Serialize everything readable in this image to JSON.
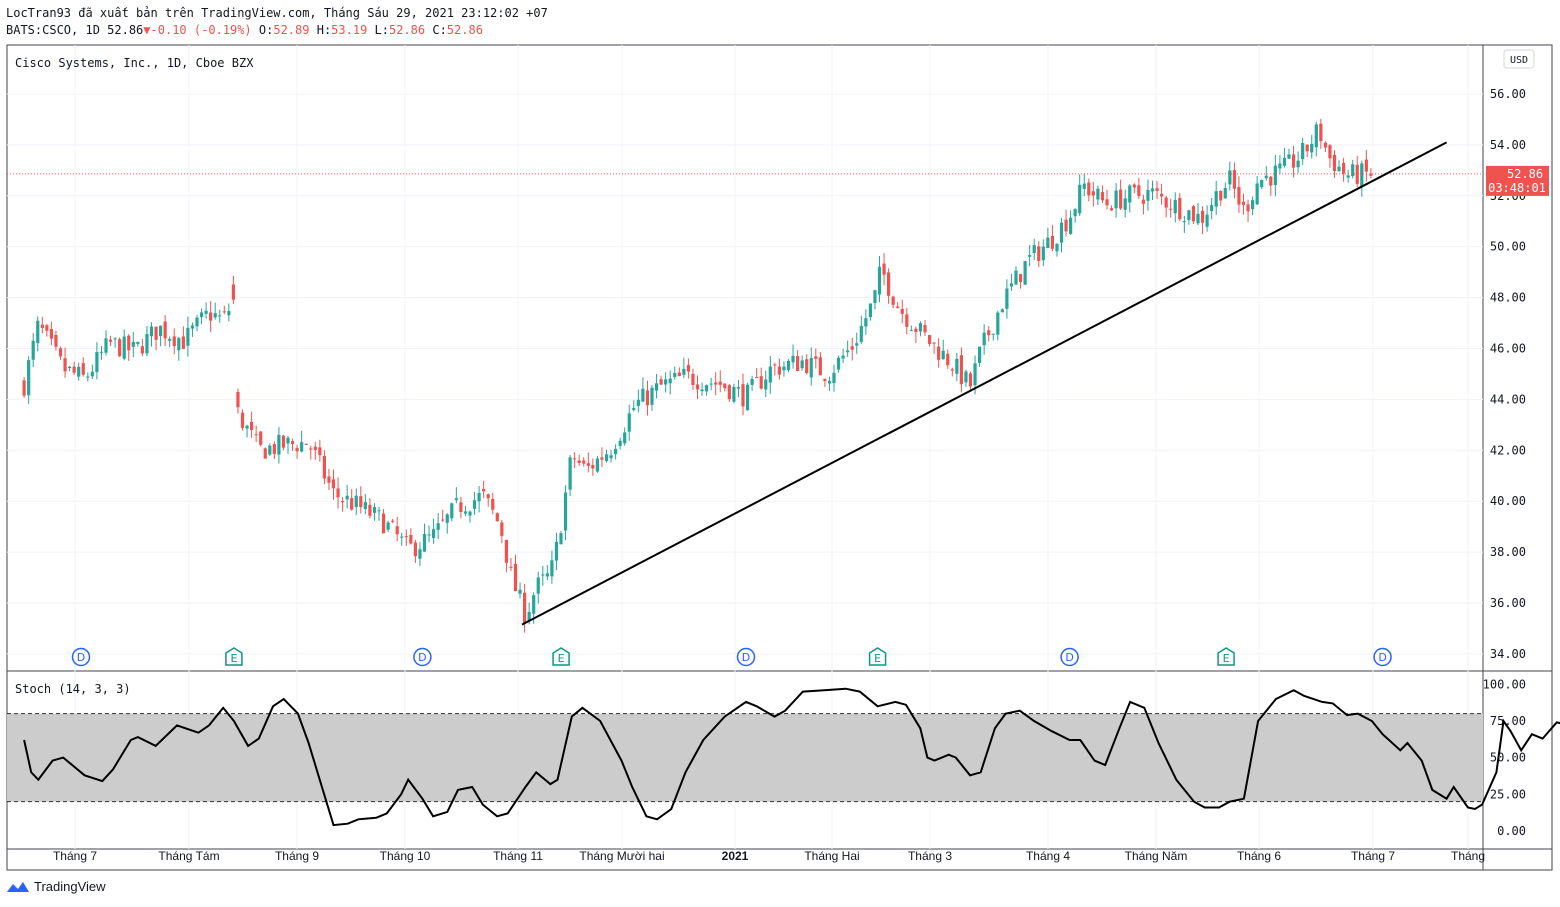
{
  "header": {
    "line1": "LocTran93 đã xuất bản trên TradingView.com, Tháng Sáu 29, 2021 23:12:02 +07",
    "symbol": "BATS:CSCO, 1D",
    "last": "52.86",
    "arrow": "▼",
    "change": "-0.10 (-0.19%)",
    "o_label": "O:",
    "o": "52.89",
    "h_label": "H:",
    "h": "53.19",
    "l_label": "L:",
    "l": "52.86",
    "c_label": "C:",
    "c": "52.86"
  },
  "footer": {
    "brand": "TradingView"
  },
  "colors": {
    "up": "#26a69a",
    "down": "#ef5350",
    "line": "#000000",
    "band": "#cccccc",
    "badge_d": "#2962ff",
    "badge_e": "#089981"
  },
  "chart_data": [
    {
      "type": "candlestick",
      "title": "Cisco Systems, Inc., 1D, Cboe BZX",
      "currency": "USD",
      "ylim": [
        34,
        56
      ],
      "yticks": [
        "56.00",
        "54.00",
        "52.00",
        "50.00",
        "48.00",
        "46.00",
        "44.00",
        "42.00",
        "40.00",
        "38.00",
        "36.00",
        "34.00"
      ],
      "last_price": "52.86",
      "countdown": "03:48:01",
      "x_labels": [
        "Tháng 7",
        "Tháng Tám",
        "Tháng 9",
        "Tháng 10",
        "Tháng 11",
        "Tháng Mười hai",
        "2021",
        "Tháng Hai",
        "Tháng 3",
        "Tháng 4",
        "Tháng Năm",
        "Tháng 6",
        "Tháng 7",
        "Tháng"
      ],
      "trendline": {
        "from": [
          "2020-11-02",
          35.15
        ],
        "to": [
          "2021-07-20",
          54.1
        ]
      },
      "markers": [
        {
          "label": "D",
          "kind": "dividend",
          "date": "2020-07-01"
        },
        {
          "label": "E",
          "kind": "earnings",
          "date": "2020-08-13"
        },
        {
          "label": "D",
          "kind": "dividend",
          "date": "2020-10-05"
        },
        {
          "label": "E",
          "kind": "earnings",
          "date": "2020-11-13"
        },
        {
          "label": "D",
          "kind": "dividend",
          "date": "2021-01-04"
        },
        {
          "label": "E",
          "kind": "earnings",
          "date": "2021-02-10"
        },
        {
          "label": "D",
          "kind": "dividend",
          "date": "2021-04-05"
        },
        {
          "label": "E",
          "kind": "earnings",
          "date": "2021-05-19"
        },
        {
          "label": "D",
          "kind": "dividend",
          "date": "2021-07-02"
        }
      ],
      "close_path": [
        [
          "2020-06-15",
          44.6
        ],
        [
          "2020-06-19",
          46.9
        ],
        [
          "2020-06-26",
          45.2
        ],
        [
          "2020-07-02",
          44.8
        ],
        [
          "2020-07-09",
          46.2
        ],
        [
          "2020-07-16",
          45.9
        ],
        [
          "2020-07-23",
          46.8
        ],
        [
          "2020-07-30",
          46.3
        ],
        [
          "2020-08-06",
          47.4
        ],
        [
          "2020-08-10",
          47.1
        ],
        [
          "2020-08-13",
          47.9
        ],
        [
          "2020-08-14",
          43.5
        ],
        [
          "2020-08-20",
          42.0
        ],
        [
          "2020-08-27",
          42.2
        ],
        [
          "2020-09-03",
          42.3
        ],
        [
          "2020-09-10",
          40.3
        ],
        [
          "2020-09-17",
          39.8
        ],
        [
          "2020-09-24",
          39.2
        ],
        [
          "2020-10-01",
          38.1
        ],
        [
          "2020-10-08",
          38.6
        ],
        [
          "2020-10-15",
          39.8
        ],
        [
          "2020-10-22",
          40.2
        ],
        [
          "2020-10-27",
          39.0
        ],
        [
          "2020-10-30",
          37.0
        ],
        [
          "2020-11-03",
          35.5
        ],
        [
          "2020-11-06",
          36.6
        ],
        [
          "2020-11-10",
          37.1
        ],
        [
          "2020-11-12",
          38.3
        ],
        [
          "2020-11-16",
          41.8
        ],
        [
          "2020-11-20",
          41.2
        ],
        [
          "2020-11-27",
          42.1
        ],
        [
          "2020-12-04",
          43.8
        ],
        [
          "2020-12-11",
          44.5
        ],
        [
          "2020-12-18",
          44.9
        ],
        [
          "2020-12-28",
          44.6
        ],
        [
          "2021-01-04",
          44.1
        ],
        [
          "2021-01-11",
          45.2
        ],
        [
          "2021-01-20",
          45.5
        ],
        [
          "2021-01-27",
          45.0
        ],
        [
          "2021-02-03",
          46.1
        ],
        [
          "2021-02-09",
          47.9
        ],
        [
          "2021-02-11",
          49.1
        ],
        [
          "2021-02-16",
          47.6
        ],
        [
          "2021-02-23",
          46.5
        ],
        [
          "2021-03-03",
          45.4
        ],
        [
          "2021-03-08",
          44.5
        ],
        [
          "2021-03-11",
          45.9
        ],
        [
          "2021-03-17",
          47.8
        ],
        [
          "2021-03-24",
          49.4
        ],
        [
          "2021-03-31",
          50.3
        ],
        [
          "2021-04-05",
          51.2
        ],
        [
          "2021-04-09",
          52.4
        ],
        [
          "2021-04-15",
          51.7
        ],
        [
          "2021-04-22",
          52.0
        ],
        [
          "2021-04-28",
          52.1
        ],
        [
          "2021-05-05",
          51.6
        ],
        [
          "2021-05-12",
          51.1
        ],
        [
          "2021-05-17",
          52.2
        ],
        [
          "2021-05-20",
          52.6
        ],
        [
          "2021-05-24",
          51.4
        ],
        [
          "2021-05-28",
          52.6
        ],
        [
          "2021-06-04",
          53.0
        ],
        [
          "2021-06-10",
          53.7
        ],
        [
          "2021-06-14",
          54.6
        ],
        [
          "2021-06-17",
          53.5
        ],
        [
          "2021-06-22",
          52.8
        ],
        [
          "2021-06-29",
          52.86
        ]
      ]
    },
    {
      "type": "line",
      "title": "Stoch (14, 3, 3)",
      "ylim": [
        0,
        100
      ],
      "yticks": [
        "100.00",
        "75.00",
        "50.00",
        "25.00",
        "0.00"
      ],
      "band": [
        20,
        80
      ],
      "series": [
        {
          "values": [
            [
              "2020-06-15",
              62
            ],
            [
              "2020-06-17",
              40
            ],
            [
              "2020-06-19",
              35
            ],
            [
              "2020-06-23",
              48
            ],
            [
              "2020-06-26",
              50
            ],
            [
              "2020-07-02",
              38
            ],
            [
              "2020-07-07",
              34
            ],
            [
              "2020-07-10",
              42
            ],
            [
              "2020-07-15",
              62
            ],
            [
              "2020-07-17",
              64
            ],
            [
              "2020-07-22",
              58
            ],
            [
              "2020-07-28",
              72
            ],
            [
              "2020-08-03",
              67
            ],
            [
              "2020-08-06",
              72
            ],
            [
              "2020-08-10",
              84
            ],
            [
              "2020-08-13",
              75
            ],
            [
              "2020-08-17",
              58
            ],
            [
              "2020-08-20",
              63
            ],
            [
              "2020-08-24",
              85
            ],
            [
              "2020-08-27",
              90
            ],
            [
              "2020-08-31",
              80
            ],
            [
              "2020-09-03",
              60
            ],
            [
              "2020-09-08",
              20
            ],
            [
              "2020-09-10",
              4
            ],
            [
              "2020-09-14",
              5
            ],
            [
              "2020-09-17",
              8
            ],
            [
              "2020-09-22",
              9
            ],
            [
              "2020-09-25",
              12
            ],
            [
              "2020-09-29",
              25
            ],
            [
              "2020-10-01",
              35
            ],
            [
              "2020-10-05",
              22
            ],
            [
              "2020-10-08",
              10
            ],
            [
              "2020-10-12",
              13
            ],
            [
              "2020-10-15",
              28
            ],
            [
              "2020-10-19",
              30
            ],
            [
              "2020-10-22",
              18
            ],
            [
              "2020-10-26",
              10
            ],
            [
              "2020-10-29",
              12
            ],
            [
              "2020-11-03",
              30
            ],
            [
              "2020-11-06",
              40
            ],
            [
              "2020-11-10",
              32
            ],
            [
              "2020-11-12",
              35
            ],
            [
              "2020-11-16",
              78
            ],
            [
              "2020-11-19",
              84
            ],
            [
              "2020-11-24",
              75
            ],
            [
              "2020-11-30",
              48
            ],
            [
              "2020-12-03",
              30
            ],
            [
              "2020-12-07",
              10
            ],
            [
              "2020-12-10",
              8
            ],
            [
              "2020-12-14",
              15
            ],
            [
              "2020-12-18",
              40
            ],
            [
              "2020-12-23",
              62
            ],
            [
              "2020-12-29",
              78
            ],
            [
              "2021-01-04",
              88
            ],
            [
              "2021-01-07",
              85
            ],
            [
              "2021-01-12",
              78
            ],
            [
              "2021-01-15",
              82
            ],
            [
              "2021-01-20",
              95
            ],
            [
              "2021-01-26",
              96
            ],
            [
              "2021-02-01",
              97
            ],
            [
              "2021-02-05",
              95
            ],
            [
              "2021-02-10",
              85
            ],
            [
              "2021-02-15",
              88
            ],
            [
              "2021-02-18",
              86
            ],
            [
              "2021-02-22",
              70
            ],
            [
              "2021-02-24",
              50
            ],
            [
              "2021-02-26",
              48
            ],
            [
              "2021-03-02",
              52
            ],
            [
              "2021-03-04",
              50
            ],
            [
              "2021-03-08",
              38
            ],
            [
              "2021-03-11",
              40
            ],
            [
              "2021-03-15",
              70
            ],
            [
              "2021-03-18",
              80
            ],
            [
              "2021-03-22",
              82
            ],
            [
              "2021-03-26",
              75
            ],
            [
              "2021-03-31",
              68
            ],
            [
              "2021-04-05",
              62
            ],
            [
              "2021-04-08",
              62
            ],
            [
              "2021-04-12",
              48
            ],
            [
              "2021-04-15",
              45
            ],
            [
              "2021-04-19",
              70
            ],
            [
              "2021-04-22",
              88
            ],
            [
              "2021-04-26",
              84
            ],
            [
              "2021-04-30",
              60
            ],
            [
              "2021-05-05",
              35
            ],
            [
              "2021-05-10",
              20
            ],
            [
              "2021-05-13",
              16
            ],
            [
              "2021-05-17",
              16
            ],
            [
              "2021-05-20",
              20
            ],
            [
              "2021-05-24",
              22
            ],
            [
              "2021-05-28",
              75
            ],
            [
              "2021-06-02",
              90
            ],
            [
              "2021-06-07",
              96
            ],
            [
              "2021-06-10",
              92
            ],
            [
              "2021-06-15",
              88
            ],
            [
              "2021-06-18",
              87
            ],
            [
              "2021-06-22",
              79
            ],
            [
              "2021-06-25",
              80
            ],
            [
              "2021-06-29",
              75
            ],
            [
              "2021-07-02",
              66
            ],
            [
              "2021-07-07",
              55
            ],
            [
              "2021-07-09",
              60
            ],
            [
              "2021-07-13",
              48
            ],
            [
              "2021-07-16",
              28
            ],
            [
              "2021-07-20",
              22
            ],
            [
              "2021-07-22",
              30
            ],
            [
              "2021-07-26",
              16
            ],
            [
              "2021-07-28",
              15
            ],
            [
              "2021-07-30",
              18
            ],
            [
              "2021-08-03",
              40
            ],
            [
              "2021-08-05",
              75
            ],
            [
              "2021-08-07",
              68
            ],
            [
              "2021-08-10",
              55
            ],
            [
              "2021-08-13",
              66
            ],
            [
              "2021-08-16",
              63
            ],
            [
              "2021-08-20",
              74
            ],
            [
              "2021-08-24",
              72
            ],
            [
              "2021-08-27",
              75
            ],
            [
              "2021-09-01",
              90
            ],
            [
              "2021-09-06",
              92
            ],
            [
              "2021-09-10",
              85
            ],
            [
              "2021-09-15",
              50
            ],
            [
              "2021-09-18",
              30
            ],
            [
              "2021-09-21",
              25
            ],
            [
              "2021-09-24",
              30
            ],
            [
              "2021-09-28",
              30
            ]
          ]
        }
      ]
    }
  ]
}
